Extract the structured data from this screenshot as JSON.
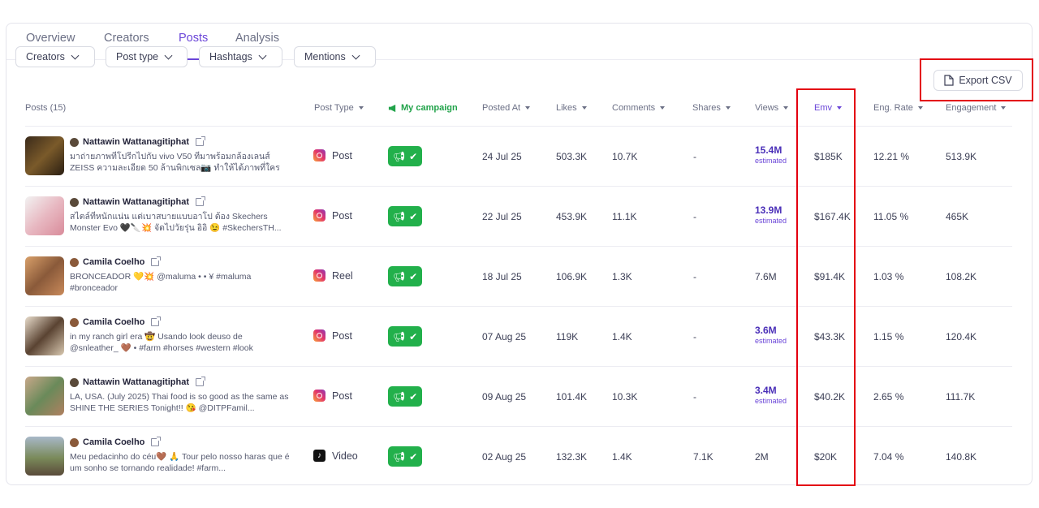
{
  "tabs": [
    {
      "label": "Overview",
      "active": false
    },
    {
      "label": "Creators",
      "active": false
    },
    {
      "label": "Posts",
      "active": true
    },
    {
      "label": "Analysis",
      "active": false
    }
  ],
  "filters": [
    "Creators",
    "Post type",
    "Hashtags",
    "Mentions"
  ],
  "export_label": "Export CSV",
  "columns": {
    "posts": "Posts (15)",
    "post_type": "Post Type",
    "campaign": "My campaign",
    "posted_at": "Posted At",
    "likes": "Likes",
    "comments": "Comments",
    "shares": "Shares",
    "views": "Views",
    "emv": "Emv",
    "eng_rate": "Eng. Rate",
    "engagement": "Engagement"
  },
  "colors": {
    "accent": "#6a45d8",
    "campaign_green": "#22b04b",
    "highlight_red": "#e3000f"
  },
  "rows": [
    {
      "creator": "Nattawin Wattanagitiphat",
      "caption": "มาถ่ายภาพที่โปรีกไปกับ vivo V50 ที่มาพร้อมกล้องเลนส์ ZEISS ความละเอียด 50 ล้านพิกเซล📷 ทำให้ได้ภาพที่ใครต่างต้อง...",
      "post_type": "Post",
      "platform": "instagram",
      "posted_at": "24 Jul 25",
      "likes": "503.3K",
      "comments": "10.7K",
      "shares": "-",
      "views": "15.4M",
      "views_note": "estimated",
      "emv": "$185K",
      "eng_rate": "12.21 %",
      "engagement": "513.9K"
    },
    {
      "creator": "Nattawin Wattanagitiphat",
      "caption": "สไตล์ที่หนักแน่น แต่เบาสบายแบบอาโป ต้อง Skechers Monster Evo 🖤🔪💥 จัดไปวัยรุ่น อิอิ 😉 #SkechersTH...",
      "post_type": "Post",
      "platform": "instagram",
      "posted_at": "22 Jul 25",
      "likes": "453.9K",
      "comments": "11.1K",
      "shares": "-",
      "views": "13.9M",
      "views_note": "estimated",
      "emv": "$167.4K",
      "eng_rate": "11.05 %",
      "engagement": "465K"
    },
    {
      "creator": "Camila Coelho",
      "caption": "BRONCEADOR 💛💥 @maluma • • ¥ #maluma #bronceador",
      "post_type": "Reel",
      "platform": "instagram",
      "posted_at": "18 Jul 25",
      "likes": "106.9K",
      "comments": "1.3K",
      "shares": "-",
      "views": "7.6M",
      "views_note": "",
      "emv": "$91.4K",
      "eng_rate": "1.03 %",
      "engagement": "108.2K"
    },
    {
      "creator": "Camila Coelho",
      "caption": "in my ranch girl era 🤠 Usando look deuso de @snleather_ 🤎 • #farm #horses #western #look",
      "post_type": "Post",
      "platform": "instagram",
      "posted_at": "07 Aug 25",
      "likes": "119K",
      "comments": "1.4K",
      "shares": "-",
      "views": "3.6M",
      "views_note": "estimated",
      "emv": "$43.3K",
      "eng_rate": "1.15 %",
      "engagement": "120.4K"
    },
    {
      "creator": "Nattawin Wattanagitiphat",
      "caption": "LA, USA. (July 2025) Thai food is so good as the same as SHINE THE SERIES Tonight!! 😘 @DITPFamil...",
      "post_type": "Post",
      "platform": "instagram",
      "posted_at": "09 Aug 25",
      "likes": "101.4K",
      "comments": "10.3K",
      "shares": "-",
      "views": "3.4M",
      "views_note": "estimated",
      "emv": "$40.2K",
      "eng_rate": "2.65 %",
      "engagement": "111.7K"
    },
    {
      "creator": "Camila Coelho",
      "caption": "Meu pedacinho do céu🤎 🙏 Tour pelo nosso haras que é um sonho se tornando realidade! #farm...",
      "post_type": "Video",
      "platform": "tiktok",
      "posted_at": "02 Aug 25",
      "likes": "132.3K",
      "comments": "1.4K",
      "shares": "7.1K",
      "views": "2M",
      "views_note": "",
      "emv": "$20K",
      "eng_rate": "7.04 %",
      "engagement": "140.8K"
    }
  ]
}
